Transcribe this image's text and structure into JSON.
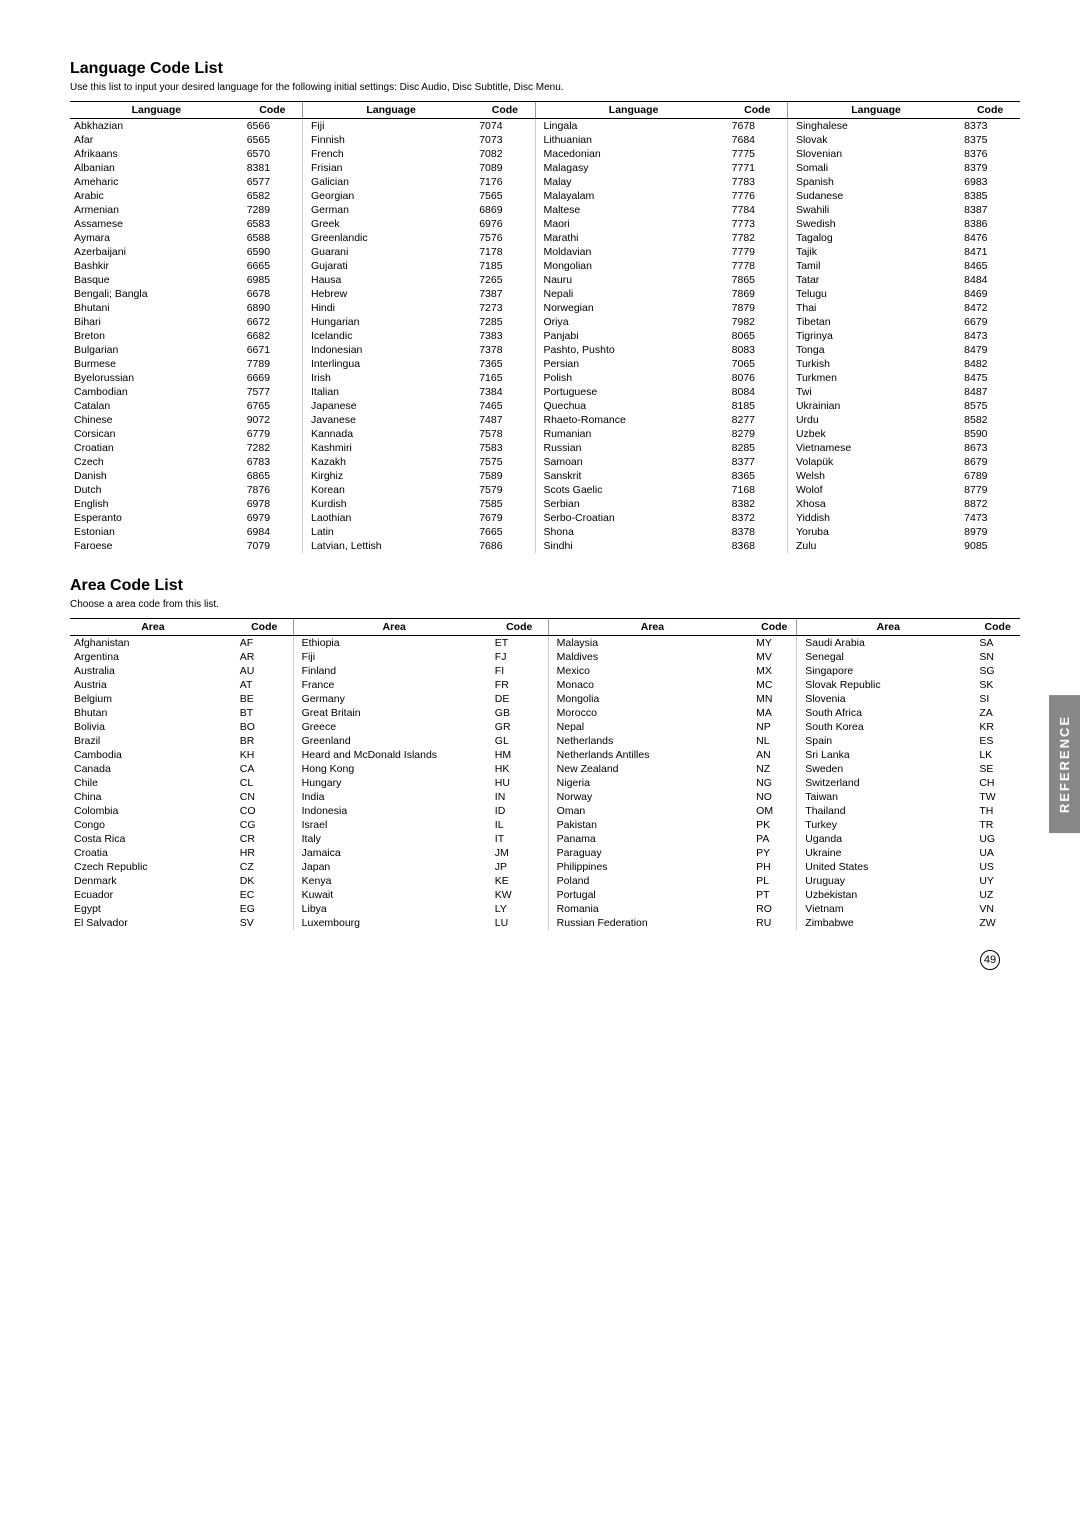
{
  "page": {
    "number": "49",
    "side_tab": "REFERENCE"
  },
  "language_section": {
    "title": "Language Code List",
    "description": "Use this list to input your desired language for the following initial settings: Disc Audio, Disc Subtitle, Disc Menu.",
    "columns": [
      {
        "header_lang": "Language",
        "header_code": "Code"
      },
      {
        "header_lang": "Language",
        "header_code": "Code"
      },
      {
        "header_lang": "Language",
        "header_code": "Code"
      },
      {
        "header_lang": "Language",
        "header_code": "Code"
      }
    ],
    "col1": [
      [
        "Abkhazian",
        "6566"
      ],
      [
        "Afar",
        "6565"
      ],
      [
        "Afrikaans",
        "6570"
      ],
      [
        "Albanian",
        "8381"
      ],
      [
        "Ameharic",
        "6577"
      ],
      [
        "Arabic",
        "6582"
      ],
      [
        "Armenian",
        "7289"
      ],
      [
        "Assamese",
        "6583"
      ],
      [
        "Aymara",
        "6588"
      ],
      [
        "Azerbaijani",
        "6590"
      ],
      [
        "Bashkir",
        "6665"
      ],
      [
        "Basque",
        "6985"
      ],
      [
        "Bengali; Bangla",
        "6678"
      ],
      [
        "Bhutani",
        "6890"
      ],
      [
        "Bihari",
        "6672"
      ],
      [
        "Breton",
        "6682"
      ],
      [
        "Bulgarian",
        "6671"
      ],
      [
        "Burmese",
        "7789"
      ],
      [
        "Byelorussian",
        "6669"
      ],
      [
        "Cambodian",
        "7577"
      ],
      [
        "Catalan",
        "6765"
      ],
      [
        "Chinese",
        "9072"
      ],
      [
        "Corsican",
        "6779"
      ],
      [
        "Croatian",
        "7282"
      ],
      [
        "Czech",
        "6783"
      ],
      [
        "Danish",
        "6865"
      ],
      [
        "Dutch",
        "7876"
      ],
      [
        "English",
        "6978"
      ],
      [
        "Esperanto",
        "6979"
      ],
      [
        "Estonian",
        "6984"
      ],
      [
        "Faroese",
        "7079"
      ]
    ],
    "col2": [
      [
        "Fiji",
        "7074"
      ],
      [
        "Finnish",
        "7073"
      ],
      [
        "French",
        "7082"
      ],
      [
        "Frisian",
        "7089"
      ],
      [
        "Galician",
        "7176"
      ],
      [
        "Georgian",
        "7565"
      ],
      [
        "German",
        "6869"
      ],
      [
        "Greek",
        "6976"
      ],
      [
        "Greenlandic",
        "7576"
      ],
      [
        "Guarani",
        "7178"
      ],
      [
        "Gujarati",
        "7185"
      ],
      [
        "Hausa",
        "7265"
      ],
      [
        "Hebrew",
        "7387"
      ],
      [
        "Hindi",
        "7273"
      ],
      [
        "Hungarian",
        "7285"
      ],
      [
        "Icelandic",
        "7383"
      ],
      [
        "Indonesian",
        "7378"
      ],
      [
        "Interlingua",
        "7365"
      ],
      [
        "Irish",
        "7165"
      ],
      [
        "Italian",
        "7384"
      ],
      [
        "Japanese",
        "7465"
      ],
      [
        "Javanese",
        "7487"
      ],
      [
        "Kannada",
        "7578"
      ],
      [
        "Kashmiri",
        "7583"
      ],
      [
        "Kazakh",
        "7575"
      ],
      [
        "Kirghiz",
        "7589"
      ],
      [
        "Korean",
        "7579"
      ],
      [
        "Kurdish",
        "7585"
      ],
      [
        "Laothian",
        "7679"
      ],
      [
        "Latin",
        "7665"
      ],
      [
        "Latvian, Lettish",
        "7686"
      ]
    ],
    "col3": [
      [
        "Lingala",
        "7678"
      ],
      [
        "Lithuanian",
        "7684"
      ],
      [
        "Macedonian",
        "7775"
      ],
      [
        "Malagasy",
        "7771"
      ],
      [
        "Malay",
        "7783"
      ],
      [
        "Malayalam",
        "7776"
      ],
      [
        "Maltese",
        "7784"
      ],
      [
        "Maori",
        "7773"
      ],
      [
        "Marathi",
        "7782"
      ],
      [
        "Moldavian",
        "7779"
      ],
      [
        "Mongolian",
        "7778"
      ],
      [
        "Nauru",
        "7865"
      ],
      [
        "Nepali",
        "7869"
      ],
      [
        "Norwegian",
        "7879"
      ],
      [
        "Oriya",
        "7982"
      ],
      [
        "Panjabi",
        "8065"
      ],
      [
        "Pashto, Pushto",
        "8083"
      ],
      [
        "Persian",
        "7065"
      ],
      [
        "Polish",
        "8076"
      ],
      [
        "Portuguese",
        "8084"
      ],
      [
        "Quechua",
        "8185"
      ],
      [
        "Rhaeto-Romance",
        "8277"
      ],
      [
        "Rumanian",
        "8279"
      ],
      [
        "Russian",
        "8285"
      ],
      [
        "Samoan",
        "8377"
      ],
      [
        "Sanskrit",
        "8365"
      ],
      [
        "Scots Gaelic",
        "7168"
      ],
      [
        "Serbian",
        "8382"
      ],
      [
        "Serbo-Croatian",
        "8372"
      ],
      [
        "Shona",
        "8378"
      ],
      [
        "Sindhi",
        "8368"
      ]
    ],
    "col4": [
      [
        "Singhalese",
        "8373"
      ],
      [
        "Slovak",
        "8375"
      ],
      [
        "Slovenian",
        "8376"
      ],
      [
        "Somali",
        "8379"
      ],
      [
        "Spanish",
        "6983"
      ],
      [
        "Sudanese",
        "8385"
      ],
      [
        "Swahili",
        "8387"
      ],
      [
        "Swedish",
        "8386"
      ],
      [
        "Tagalog",
        "8476"
      ],
      [
        "Tajik",
        "8471"
      ],
      [
        "Tamil",
        "8465"
      ],
      [
        "Tatar",
        "8484"
      ],
      [
        "Telugu",
        "8469"
      ],
      [
        "Thai",
        "8472"
      ],
      [
        "Tibetan",
        "6679"
      ],
      [
        "Tigrinya",
        "8473"
      ],
      [
        "Tonga",
        "8479"
      ],
      [
        "Turkish",
        "8482"
      ],
      [
        "Turkmen",
        "8475"
      ],
      [
        "Twi",
        "8487"
      ],
      [
        "Ukrainian",
        "8575"
      ],
      [
        "Urdu",
        "8582"
      ],
      [
        "Uzbek",
        "8590"
      ],
      [
        "Vietnamese",
        "8673"
      ],
      [
        "Volapük",
        "8679"
      ],
      [
        "Welsh",
        "6789"
      ],
      [
        "Wolof",
        "8779"
      ],
      [
        "Xhosa",
        "8872"
      ],
      [
        "Yiddish",
        "7473"
      ],
      [
        "Yoruba",
        "8979"
      ],
      [
        "Zulu",
        "9085"
      ]
    ]
  },
  "area_section": {
    "title": "Area Code List",
    "description": "Choose a area code from this list.",
    "col1": [
      [
        "Afghanistan",
        "AF"
      ],
      [
        "Argentina",
        "AR"
      ],
      [
        "Australia",
        "AU"
      ],
      [
        "Austria",
        "AT"
      ],
      [
        "Belgium",
        "BE"
      ],
      [
        "Bhutan",
        "BT"
      ],
      [
        "Bolivia",
        "BO"
      ],
      [
        "Brazil",
        "BR"
      ],
      [
        "Cambodia",
        "KH"
      ],
      [
        "Canada",
        "CA"
      ],
      [
        "Chile",
        "CL"
      ],
      [
        "China",
        "CN"
      ],
      [
        "Colombia",
        "CO"
      ],
      [
        "Congo",
        "CG"
      ],
      [
        "Costa Rica",
        "CR"
      ],
      [
        "Croatia",
        "HR"
      ],
      [
        "Czech Republic",
        "CZ"
      ],
      [
        "Denmark",
        "DK"
      ],
      [
        "Ecuador",
        "EC"
      ],
      [
        "Egypt",
        "EG"
      ],
      [
        "El Salvador",
        "SV"
      ]
    ],
    "col2": [
      [
        "Ethiopia",
        "ET"
      ],
      [
        "Fiji",
        "FJ"
      ],
      [
        "Finland",
        "FI"
      ],
      [
        "France",
        "FR"
      ],
      [
        "Germany",
        "DE"
      ],
      [
        "Great Britain",
        "GB"
      ],
      [
        "Greece",
        "GR"
      ],
      [
        "Greenland",
        "GL"
      ],
      [
        "Heard and McDonald Islands",
        "HM"
      ],
      [
        "Hong Kong",
        "HK"
      ],
      [
        "Hungary",
        "HU"
      ],
      [
        "India",
        "IN"
      ],
      [
        "Indonesia",
        "ID"
      ],
      [
        "Israel",
        "IL"
      ],
      [
        "Italy",
        "IT"
      ],
      [
        "Jamaica",
        "JM"
      ],
      [
        "Japan",
        "JP"
      ],
      [
        "Kenya",
        "KE"
      ],
      [
        "Kuwait",
        "KW"
      ],
      [
        "Libya",
        "LY"
      ],
      [
        "Luxembourg",
        "LU"
      ]
    ],
    "col3": [
      [
        "Malaysia",
        "MY"
      ],
      [
        "Maldives",
        "MV"
      ],
      [
        "Mexico",
        "MX"
      ],
      [
        "Monaco",
        "MC"
      ],
      [
        "Mongolia",
        "MN"
      ],
      [
        "Morocco",
        "MA"
      ],
      [
        "Nepal",
        "NP"
      ],
      [
        "Netherlands",
        "NL"
      ],
      [
        "Netherlands Antilles",
        "AN"
      ],
      [
        "New Zealand",
        "NZ"
      ],
      [
        "Nigeria",
        "NG"
      ],
      [
        "Norway",
        "NO"
      ],
      [
        "Oman",
        "OM"
      ],
      [
        "Pakistan",
        "PK"
      ],
      [
        "Panama",
        "PA"
      ],
      [
        "Paraguay",
        "PY"
      ],
      [
        "Philippines",
        "PH"
      ],
      [
        "Poland",
        "PL"
      ],
      [
        "Portugal",
        "PT"
      ],
      [
        "Romania",
        "RO"
      ],
      [
        "Russian Federation",
        "RU"
      ]
    ],
    "col4": [
      [
        "Saudi Arabia",
        "SA"
      ],
      [
        "Senegal",
        "SN"
      ],
      [
        "Singapore",
        "SG"
      ],
      [
        "Slovak Republic",
        "SK"
      ],
      [
        "Slovenia",
        "SI"
      ],
      [
        "South Africa",
        "ZA"
      ],
      [
        "South Korea",
        "KR"
      ],
      [
        "Spain",
        "ES"
      ],
      [
        "Sri Lanka",
        "LK"
      ],
      [
        "Sweden",
        "SE"
      ],
      [
        "Switzerland",
        "CH"
      ],
      [
        "Taiwan",
        "TW"
      ],
      [
        "Thailand",
        "TH"
      ],
      [
        "Turkey",
        "TR"
      ],
      [
        "Uganda",
        "UG"
      ],
      [
        "Ukraine",
        "UA"
      ],
      [
        "United States",
        "US"
      ],
      [
        "Uruguay",
        "UY"
      ],
      [
        "Uzbekistan",
        "UZ"
      ],
      [
        "Vietnam",
        "VN"
      ],
      [
        "Zimbabwe",
        "ZW"
      ]
    ]
  }
}
